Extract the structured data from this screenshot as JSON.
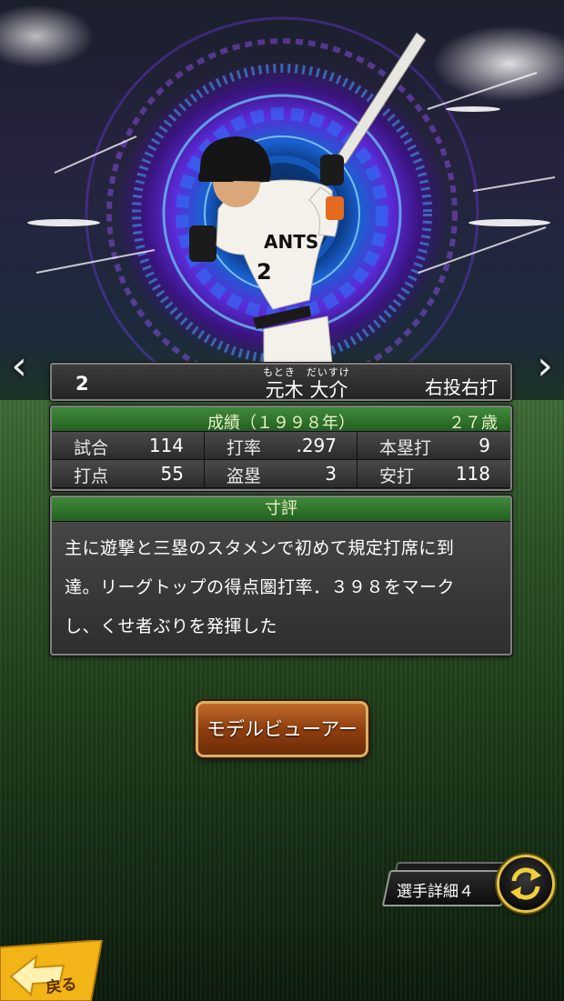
{
  "player": {
    "number": "2",
    "name_ruby": "もとき　だいすけ",
    "name": "元木 大介",
    "handedness": "右投右打",
    "jersey_text": "ANTS",
    "jersey_number": "2"
  },
  "stats": {
    "title": "成績（１９９８年）",
    "age": "２７歳",
    "items": [
      {
        "label": "試合",
        "value": "114"
      },
      {
        "label": "打率",
        "value": ".297"
      },
      {
        "label": "本塁打",
        "value": "9"
      },
      {
        "label": "打点",
        "value": "55"
      },
      {
        "label": "盗塁",
        "value": "3"
      },
      {
        "label": "安打",
        "value": "118"
      }
    ]
  },
  "comment": {
    "title": "寸評",
    "lines": [
      "主に遊撃と三塁のスタメンで初めて規定打席に到",
      "達。リーグトップの得点圏打率．３９８をマーク",
      "し、くせ者ぶりを発揮した"
    ]
  },
  "buttons": {
    "model_viewer": "モデルビューアー",
    "player_detail": "選手詳細４",
    "back": "戻る"
  },
  "icons": {
    "nav_prev": "chevron-left-icon",
    "nav_next": "chevron-right-icon",
    "swap": "swap-arrows-icon",
    "back": "back-arrow-icon"
  },
  "colors": {
    "header_green": "#2f7a2a",
    "button_brown": "#8f3f0f",
    "gold": "#e3c244",
    "back_yellow": "#f2b416"
  }
}
